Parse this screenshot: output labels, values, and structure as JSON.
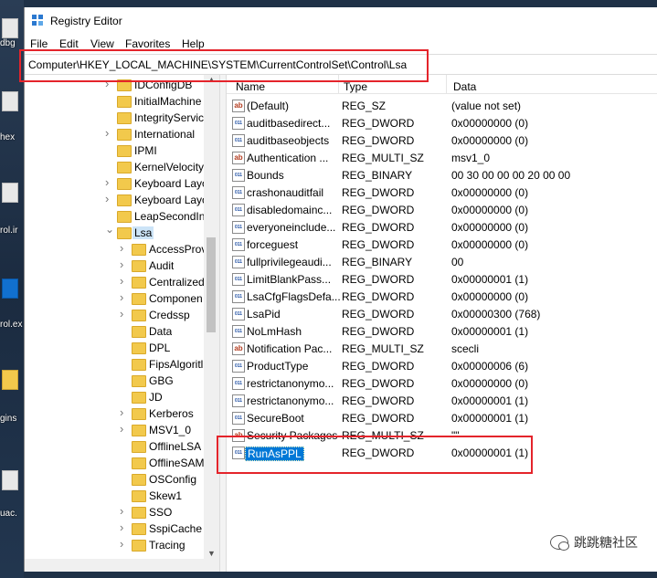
{
  "desktop": {
    "items": [
      {
        "label": "dbg"
      },
      {
        "label": "hex"
      },
      {
        "label": "rol.ir"
      },
      {
        "label": "rol.ex"
      },
      {
        "label": "gins"
      },
      {
        "label": "uac."
      }
    ]
  },
  "window": {
    "title": "Registry Editor",
    "icon": "registry-icon"
  },
  "menu": {
    "items": [
      "File",
      "Edit",
      "View",
      "Favorites",
      "Help"
    ]
  },
  "address": {
    "path": "Computer\\HKEY_LOCAL_MACHINE\\SYSTEM\\CurrentControlSet\\Control\\Lsa"
  },
  "tree": {
    "items": [
      {
        "label": "IDConfigDB",
        "level": 0,
        "expander": "closed"
      },
      {
        "label": "InitialMachine",
        "level": 0,
        "expander": "none"
      },
      {
        "label": "IntegrityServic",
        "level": 0,
        "expander": "none"
      },
      {
        "label": "International",
        "level": 0,
        "expander": "closed"
      },
      {
        "label": "IPMI",
        "level": 0,
        "expander": "none"
      },
      {
        "label": "KernelVelocity",
        "level": 0,
        "expander": "none"
      },
      {
        "label": "Keyboard Layo",
        "level": 0,
        "expander": "closed"
      },
      {
        "label": "Keyboard Layo",
        "level": 0,
        "expander": "closed"
      },
      {
        "label": "LeapSecondIn",
        "level": 0,
        "expander": "none"
      },
      {
        "label": "Lsa",
        "level": 0,
        "expander": "open",
        "selected": true
      },
      {
        "label": "AccessProv",
        "level": 1,
        "expander": "closed"
      },
      {
        "label": "Audit",
        "level": 1,
        "expander": "closed"
      },
      {
        "label": "Centralized",
        "level": 1,
        "expander": "closed"
      },
      {
        "label": "Componen",
        "level": 1,
        "expander": "closed"
      },
      {
        "label": "Credssp",
        "level": 1,
        "expander": "closed"
      },
      {
        "label": "Data",
        "level": 1,
        "expander": "none"
      },
      {
        "label": "DPL",
        "level": 1,
        "expander": "none"
      },
      {
        "label": "FipsAlgoritl",
        "level": 1,
        "expander": "none"
      },
      {
        "label": "GBG",
        "level": 1,
        "expander": "none"
      },
      {
        "label": "JD",
        "level": 1,
        "expander": "none"
      },
      {
        "label": "Kerberos",
        "level": 1,
        "expander": "closed"
      },
      {
        "label": "MSV1_0",
        "level": 1,
        "expander": "closed"
      },
      {
        "label": "OfflineLSA",
        "level": 1,
        "expander": "none"
      },
      {
        "label": "OfflineSAM",
        "level": 1,
        "expander": "none"
      },
      {
        "label": "OSConfig",
        "level": 1,
        "expander": "none"
      },
      {
        "label": "Skew1",
        "level": 1,
        "expander": "none"
      },
      {
        "label": "SSO",
        "level": 1,
        "expander": "closed"
      },
      {
        "label": "SspiCache",
        "level": 1,
        "expander": "closed"
      },
      {
        "label": "Tracing",
        "level": 1,
        "expander": "closed"
      }
    ]
  },
  "list": {
    "columns": {
      "name": "Name",
      "type": "Type",
      "data": "Data"
    },
    "rows": [
      {
        "name": "(Default)",
        "type": "REG_SZ",
        "data": "(value not set)",
        "icon": "sz"
      },
      {
        "name": "auditbasedirect...",
        "type": "REG_DWORD",
        "data": "0x00000000 (0)",
        "icon": "bin"
      },
      {
        "name": "auditbaseobjects",
        "type": "REG_DWORD",
        "data": "0x00000000 (0)",
        "icon": "bin"
      },
      {
        "name": "Authentication ...",
        "type": "REG_MULTI_SZ",
        "data": "msv1_0",
        "icon": "sz"
      },
      {
        "name": "Bounds",
        "type": "REG_BINARY",
        "data": "00 30 00 00 00 20 00 00",
        "icon": "bin"
      },
      {
        "name": "crashonauditfail",
        "type": "REG_DWORD",
        "data": "0x00000000 (0)",
        "icon": "bin"
      },
      {
        "name": "disabledomainc...",
        "type": "REG_DWORD",
        "data": "0x00000000 (0)",
        "icon": "bin"
      },
      {
        "name": "everyoneinclude...",
        "type": "REG_DWORD",
        "data": "0x00000000 (0)",
        "icon": "bin"
      },
      {
        "name": "forceguest",
        "type": "REG_DWORD",
        "data": "0x00000000 (0)",
        "icon": "bin"
      },
      {
        "name": "fullprivilegeaudi...",
        "type": "REG_BINARY",
        "data": "00",
        "icon": "bin"
      },
      {
        "name": "LimitBlankPass...",
        "type": "REG_DWORD",
        "data": "0x00000001 (1)",
        "icon": "bin"
      },
      {
        "name": "LsaCfgFlagsDefa...",
        "type": "REG_DWORD",
        "data": "0x00000000 (0)",
        "icon": "bin"
      },
      {
        "name": "LsaPid",
        "type": "REG_DWORD",
        "data": "0x00000300 (768)",
        "icon": "bin"
      },
      {
        "name": "NoLmHash",
        "type": "REG_DWORD",
        "data": "0x00000001 (1)",
        "icon": "bin"
      },
      {
        "name": "Notification Pac...",
        "type": "REG_MULTI_SZ",
        "data": "scecli",
        "icon": "sz"
      },
      {
        "name": "ProductType",
        "type": "REG_DWORD",
        "data": "0x00000006 (6)",
        "icon": "bin"
      },
      {
        "name": "restrictanonymo...",
        "type": "REG_DWORD",
        "data": "0x00000000 (0)",
        "icon": "bin"
      },
      {
        "name": "restrictanonymo...",
        "type": "REG_DWORD",
        "data": "0x00000001 (1)",
        "icon": "bin"
      },
      {
        "name": "SecureBoot",
        "type": "REG_DWORD",
        "data": "0x00000001 (1)",
        "icon": "bin"
      },
      {
        "name": "Security Packages",
        "type": "REG_MULTI_SZ",
        "data": "\"\"",
        "icon": "sz"
      },
      {
        "name": "RunAsPPL",
        "type": "REG_DWORD",
        "data": "0x00000001 (1)",
        "icon": "bin",
        "selected": true
      }
    ]
  },
  "watermark": {
    "text": "跳跳糖社区"
  },
  "colors": {
    "highlight": "#e4242b",
    "selection": "#0078d7",
    "tree_selection": "#cce4f7",
    "folder": "#f2c94c"
  }
}
